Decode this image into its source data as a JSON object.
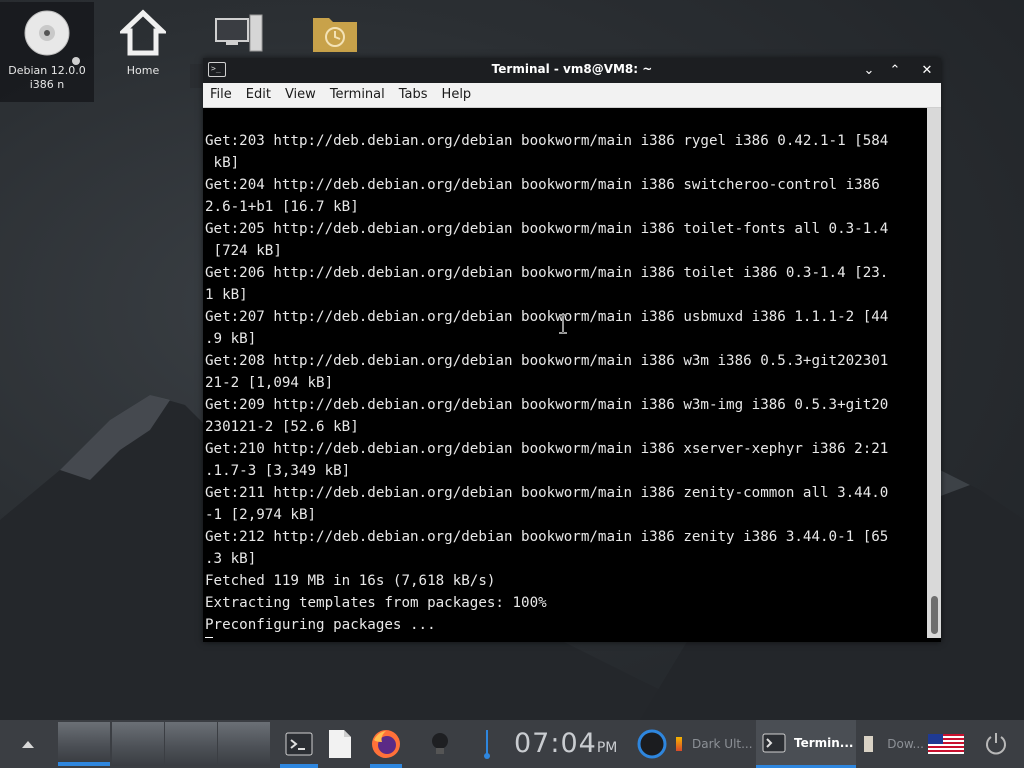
{
  "desktop": {
    "icons": [
      {
        "label": "Debian 12.0.0 i386 n",
        "icon": "cdrom-icon"
      },
      {
        "label": "Home",
        "icon": "home-icon"
      },
      {
        "label": "",
        "icon": "computer-icon"
      },
      {
        "label": "",
        "icon": "recent-folder-icon"
      }
    ]
  },
  "window": {
    "title": "Terminal - vm8@VM8: ~",
    "menu": [
      "File",
      "Edit",
      "View",
      "Terminal",
      "Tabs",
      "Help"
    ],
    "lines": [
      "Get:203 http://deb.debian.org/debian bookworm/main i386 rygel i386 0.42.1-1 [584",
      " kB]",
      "Get:204 http://deb.debian.org/debian bookworm/main i386 switcheroo-control i386",
      "2.6-1+b1 [16.7 kB]",
      "Get:205 http://deb.debian.org/debian bookworm/main i386 toilet-fonts all 0.3-1.4",
      " [724 kB]",
      "Get:206 http://deb.debian.org/debian bookworm/main i386 toilet i386 0.3-1.4 [23.",
      "1 kB]",
      "Get:207 http://deb.debian.org/debian bookworm/main i386 usbmuxd i386 1.1.1-2 [44",
      ".9 kB]",
      "Get:208 http://deb.debian.org/debian bookworm/main i386 w3m i386 0.5.3+git202301",
      "21-2 [1,094 kB]",
      "Get:209 http://deb.debian.org/debian bookworm/main i386 w3m-img i386 0.5.3+git20",
      "230121-2 [52.6 kB]",
      "Get:210 http://deb.debian.org/debian bookworm/main i386 xserver-xephyr i386 2:21",
      ".1.7-3 [3,349 kB]",
      "Get:211 http://deb.debian.org/debian bookworm/main i386 zenity-common all 3.44.0",
      "-1 [2,974 kB]",
      "Get:212 http://deb.debian.org/debian bookworm/main i386 zenity i386 3.44.0-1 [65",
      ".3 kB]",
      "Fetched 119 MB in 16s (7,618 kB/s)",
      "Extracting templates from packages: 100%",
      "Preconfiguring packages ..."
    ]
  },
  "taskbar": {
    "clock": {
      "time": "07:04",
      "ampm": "PM"
    },
    "tasks": [
      {
        "label": "Dark Ult..."
      },
      {
        "label": "Termin..."
      },
      {
        "label": "Dow..."
      }
    ],
    "accent": "#2e86de"
  }
}
